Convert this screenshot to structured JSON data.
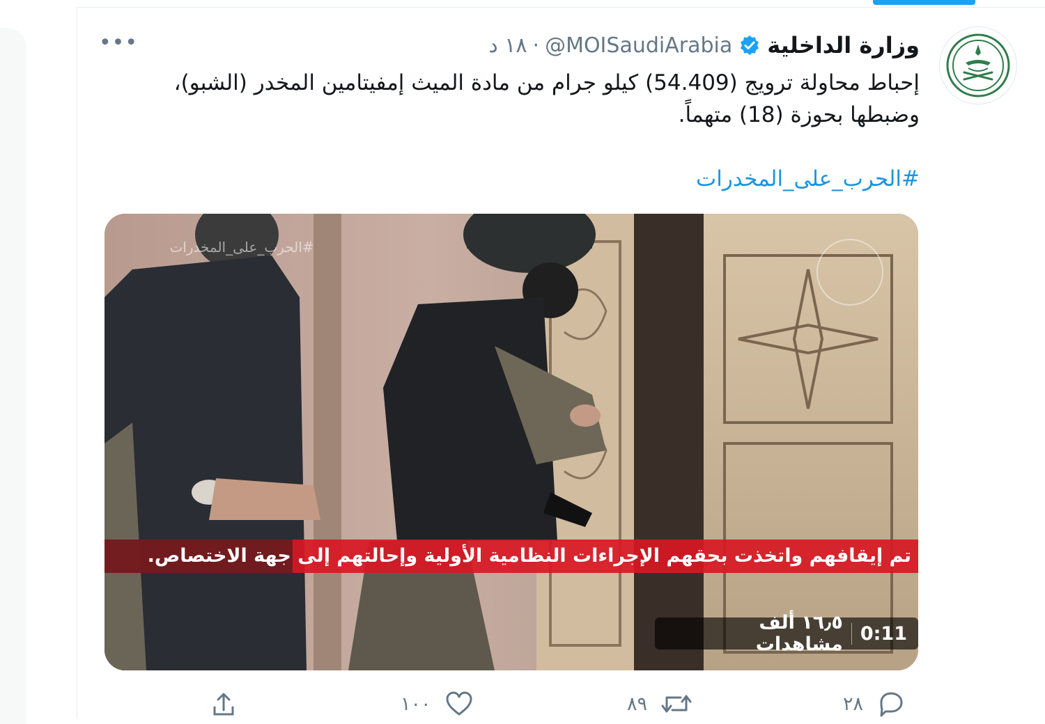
{
  "account": {
    "display_name": "وزارة الداخلية",
    "handle": "@MOISaudiArabia",
    "separator": "·",
    "timestamp": "١٨ د",
    "verified": true
  },
  "tweet": {
    "line1": "إحباط محاولة ترويج (54.409) كيلو جرام من مادة الميث إمفيتامين المخدر (الشبو)،",
    "line2": "وضبطها بحوزة (18) متهماً.",
    "hashtag": "#الحرب_على_المخدرات"
  },
  "media": {
    "type": "video",
    "watermark_hashtag": "#الحرب_على_المخدرات",
    "caption": "تم إيقافهم واتخذت بحقهم الإجراءات النظامية الأولية وإحالتهم إلى جهة الاختصاص.",
    "duration": "0:11",
    "views": "١٦٫٥ ألف مشاهدات"
  },
  "actions": {
    "reply_count": "٢٨",
    "retweet_count": "٨٩",
    "like_count": "١٠٠",
    "icons": [
      "reply-icon",
      "retweet-icon",
      "like-icon",
      "share-icon"
    ]
  },
  "more_label": "•••",
  "colors": {
    "link": "#1b95e0",
    "verified": "#1da1f2",
    "caption_bar": "#d81824",
    "secondary_text": "#657786"
  }
}
